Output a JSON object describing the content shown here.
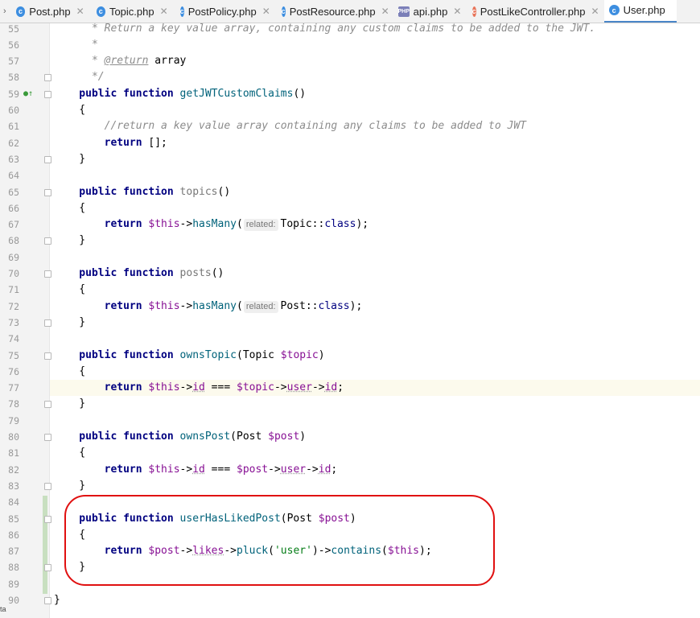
{
  "tabs": [
    {
      "label": "Post.php",
      "icon": "class-icon"
    },
    {
      "label": "Topic.php",
      "icon": "class-icon"
    },
    {
      "label": "PostPolicy.php",
      "icon": "class-icon"
    },
    {
      "label": "PostResource.php",
      "icon": "class-icon"
    },
    {
      "label": "api.php",
      "icon": "php-file-icon"
    },
    {
      "label": "PostLikeController.php",
      "icon": "class-icon"
    },
    {
      "label": "User.php",
      "icon": "class-icon",
      "active": true
    }
  ],
  "tab_icon_glyph": "c",
  "php_icon_text": "PHP",
  "close_glyph": "✕",
  "overflow_glyph": "›",
  "gutter_icon": "implements-icon",
  "corner_text": "ta",
  "lines": [
    {
      "n": "55",
      "fold": false,
      "tokens": [
        [
          "comment",
          "      * Return a key value array, containing any custom claims to be added to the JWT."
        ]
      ]
    },
    {
      "n": "56",
      "fold": false,
      "tokens": [
        [
          "comment",
          "      *"
        ]
      ]
    },
    {
      "n": "57",
      "fold": false,
      "tokens": [
        [
          "comment",
          "      * "
        ],
        [
          "doctag",
          "@return"
        ],
        [
          "plain",
          " array"
        ]
      ]
    },
    {
      "n": "58",
      "fold": true,
      "tokens": [
        [
          "comment",
          "      */"
        ]
      ]
    },
    {
      "n": "59",
      "fold": true,
      "marker": true,
      "tokens": [
        [
          "kw",
          "    public function "
        ],
        [
          "fn",
          "getJWTCustomClaims"
        ],
        [
          "plain",
          "()"
        ]
      ]
    },
    {
      "n": "60",
      "fold": false,
      "tokens": [
        [
          "plain",
          "    {"
        ]
      ]
    },
    {
      "n": "61",
      "fold": false,
      "tokens": [
        [
          "comment",
          "        //return a key value array containing any claims to be added to JWT"
        ]
      ]
    },
    {
      "n": "62",
      "fold": false,
      "tokens": [
        [
          "kw",
          "        return "
        ],
        [
          "plain",
          "[];"
        ]
      ]
    },
    {
      "n": "63",
      "fold": true,
      "tokens": [
        [
          "plain",
          "    }"
        ]
      ]
    },
    {
      "n": "64",
      "fold": false,
      "tokens": []
    },
    {
      "n": "65",
      "fold": true,
      "tokens": [
        [
          "kw",
          "    public function "
        ],
        [
          "grey",
          "topics"
        ],
        [
          "plain",
          "()"
        ]
      ]
    },
    {
      "n": "66",
      "fold": false,
      "tokens": [
        [
          "plain",
          "    {"
        ]
      ]
    },
    {
      "n": "67",
      "fold": false,
      "tokens": [
        [
          "kw",
          "        return "
        ],
        [
          "var",
          "$this"
        ],
        [
          "plain",
          "->"
        ],
        [
          "fn",
          "hasMany"
        ],
        [
          "plain",
          "("
        ],
        [
          "hint",
          "related:"
        ],
        [
          "plain",
          "Topic::"
        ],
        [
          "kw2",
          "class"
        ],
        [
          "plain",
          ");"
        ]
      ]
    },
    {
      "n": "68",
      "fold": true,
      "tokens": [
        [
          "plain",
          "    }"
        ]
      ]
    },
    {
      "n": "69",
      "fold": false,
      "tokens": []
    },
    {
      "n": "70",
      "fold": true,
      "tokens": [
        [
          "kw",
          "    public function "
        ],
        [
          "grey",
          "posts"
        ],
        [
          "plain",
          "()"
        ]
      ]
    },
    {
      "n": "71",
      "fold": false,
      "tokens": [
        [
          "plain",
          "    {"
        ]
      ]
    },
    {
      "n": "72",
      "fold": false,
      "tokens": [
        [
          "kw",
          "        return "
        ],
        [
          "var",
          "$this"
        ],
        [
          "plain",
          "->"
        ],
        [
          "fn",
          "hasMany"
        ],
        [
          "plain",
          "("
        ],
        [
          "hint",
          "related:"
        ],
        [
          "plain",
          "Post::"
        ],
        [
          "kw2",
          "class"
        ],
        [
          "plain",
          ");"
        ]
      ]
    },
    {
      "n": "73",
      "fold": true,
      "tokens": [
        [
          "plain",
          "    }"
        ]
      ]
    },
    {
      "n": "74",
      "fold": false,
      "tokens": []
    },
    {
      "n": "75",
      "fold": true,
      "tokens": [
        [
          "kw",
          "    public function "
        ],
        [
          "fn",
          "ownsTopic"
        ],
        [
          "plain",
          "(Topic "
        ],
        [
          "var",
          "$topic"
        ],
        [
          "plain",
          ")"
        ]
      ]
    },
    {
      "n": "76",
      "fold": false,
      "tokens": [
        [
          "plain",
          "    {"
        ]
      ]
    },
    {
      "n": "77",
      "fold": false,
      "hl": true,
      "tokens": [
        [
          "kw",
          "        return "
        ],
        [
          "var",
          "$this"
        ],
        [
          "plain",
          "->"
        ],
        [
          "prop",
          "id"
        ],
        [
          "plain",
          " === "
        ],
        [
          "var",
          "$topic"
        ],
        [
          "plain",
          "->"
        ],
        [
          "prop",
          "user"
        ],
        [
          "plain",
          "->"
        ],
        [
          "prop",
          "id"
        ],
        [
          "plain",
          ";"
        ]
      ]
    },
    {
      "n": "78",
      "fold": true,
      "tokens": [
        [
          "plain",
          "    }"
        ]
      ]
    },
    {
      "n": "79",
      "fold": false,
      "tokens": []
    },
    {
      "n": "80",
      "fold": true,
      "tokens": [
        [
          "kw",
          "    public function "
        ],
        [
          "fn",
          "ownsPost"
        ],
        [
          "plain",
          "(Post "
        ],
        [
          "var",
          "$post"
        ],
        [
          "plain",
          ")"
        ]
      ]
    },
    {
      "n": "81",
      "fold": false,
      "tokens": [
        [
          "plain",
          "    {"
        ]
      ]
    },
    {
      "n": "82",
      "fold": false,
      "tokens": [
        [
          "kw",
          "        return "
        ],
        [
          "var",
          "$this"
        ],
        [
          "plain",
          "->"
        ],
        [
          "prop",
          "id"
        ],
        [
          "plain",
          " === "
        ],
        [
          "var",
          "$post"
        ],
        [
          "plain",
          "->"
        ],
        [
          "prop",
          "user"
        ],
        [
          "plain",
          "->"
        ],
        [
          "prop",
          "id"
        ],
        [
          "plain",
          ";"
        ]
      ]
    },
    {
      "n": "83",
      "fold": true,
      "tokens": [
        [
          "plain",
          "    }"
        ]
      ]
    },
    {
      "n": "84",
      "fold": false,
      "tokens": []
    },
    {
      "n": "85",
      "fold": true,
      "tokens": [
        [
          "kw",
          "    public function "
        ],
        [
          "fn",
          "userHasLikedPost"
        ],
        [
          "plain",
          "(Post "
        ],
        [
          "var",
          "$post"
        ],
        [
          "plain",
          ")"
        ]
      ]
    },
    {
      "n": "86",
      "fold": false,
      "tokens": [
        [
          "plain",
          "    {"
        ]
      ]
    },
    {
      "n": "87",
      "fold": false,
      "tokens": [
        [
          "kw",
          "        return "
        ],
        [
          "var",
          "$post"
        ],
        [
          "plain",
          "->"
        ],
        [
          "prop",
          "likes"
        ],
        [
          "plain",
          "->"
        ],
        [
          "fn",
          "pluck"
        ],
        [
          "plain",
          "("
        ],
        [
          "str",
          "'user'"
        ],
        [
          "plain",
          ")->"
        ],
        [
          "fn",
          "contains"
        ],
        [
          "plain",
          "("
        ],
        [
          "var",
          "$this"
        ],
        [
          "plain",
          ");"
        ]
      ]
    },
    {
      "n": "88",
      "fold": true,
      "tokens": [
        [
          "plain",
          "    }"
        ]
      ]
    },
    {
      "n": "89",
      "fold": false,
      "tokens": []
    },
    {
      "n": "90",
      "fold": true,
      "tokens": [
        [
          "plain",
          "}"
        ]
      ]
    }
  ]
}
